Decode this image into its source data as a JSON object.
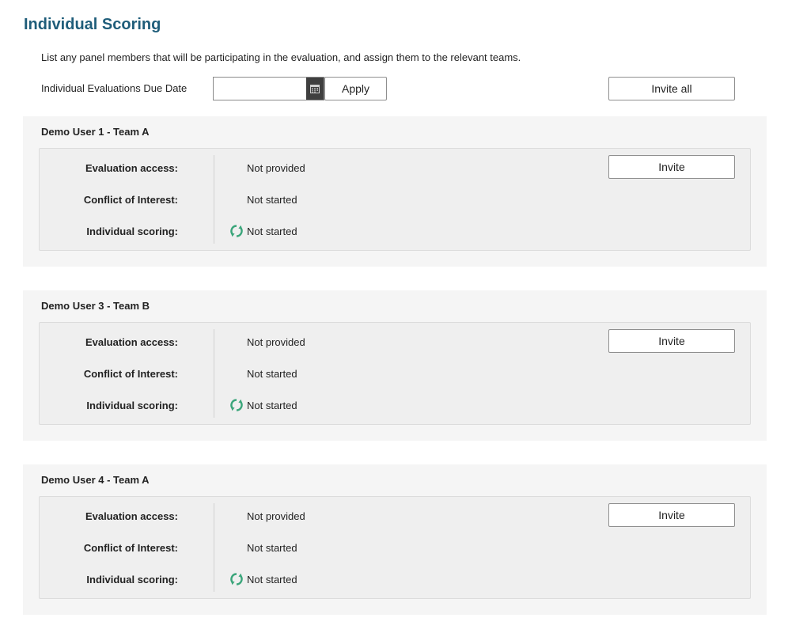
{
  "page": {
    "title": "Individual Scoring",
    "intro": "List any panel members that will be participating in the evaluation, and assign them to the relevant teams."
  },
  "due_date": {
    "label": "Individual Evaluations Due Date",
    "value": "",
    "apply_label": "Apply",
    "calendar_icon": "calendar-icon"
  },
  "invite_all_label": "Invite all",
  "colors": {
    "title": "#1f5d7a",
    "sync_icon": "#3aa57a",
    "card_bg": "#f5f5f5",
    "card_inner_bg": "#efefef"
  },
  "members": [
    {
      "title": "Demo User 1 - Team A",
      "invite_label": "Invite",
      "rows": [
        {
          "label": "Evaluation access:",
          "value": "Not provided"
        },
        {
          "label": "Conflict of Interest:",
          "value": "Not started"
        },
        {
          "label": "Individual scoring:",
          "value": "Not started",
          "icon": "sync-icon"
        }
      ]
    },
    {
      "title": "Demo User 3 - Team B",
      "invite_label": "Invite",
      "rows": [
        {
          "label": "Evaluation access:",
          "value": "Not provided"
        },
        {
          "label": "Conflict of Interest:",
          "value": "Not started"
        },
        {
          "label": "Individual scoring:",
          "value": "Not started",
          "icon": "sync-icon"
        }
      ]
    },
    {
      "title": "Demo User 4 - Team A",
      "invite_label": "Invite",
      "rows": [
        {
          "label": "Evaluation access:",
          "value": "Not provided"
        },
        {
          "label": "Conflict of Interest:",
          "value": "Not started"
        },
        {
          "label": "Individual scoring:",
          "value": "Not started",
          "icon": "sync-icon"
        }
      ]
    }
  ]
}
